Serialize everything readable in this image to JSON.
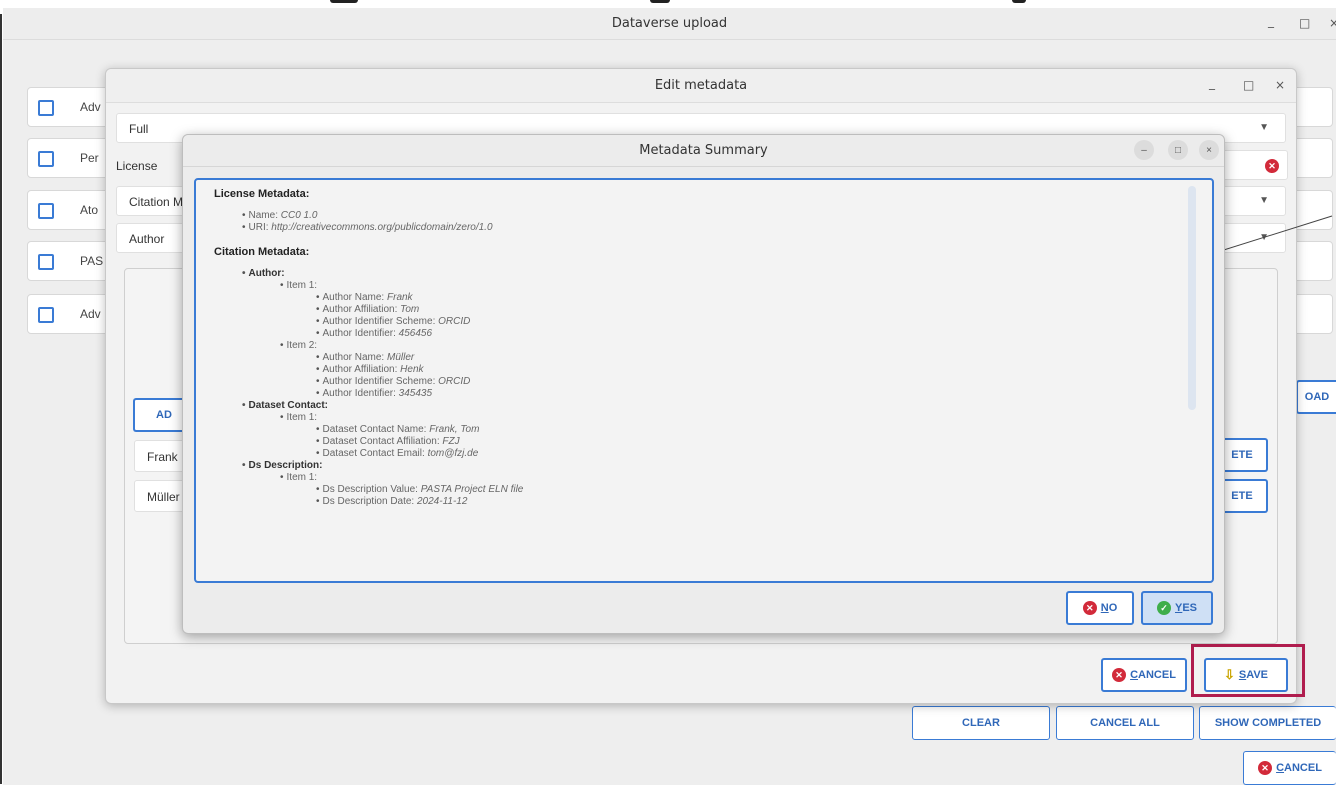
{
  "main_window": {
    "title": "Dataverse upload",
    "controls": [
      "_",
      "□",
      "×"
    ],
    "list_items": [
      "Adv",
      "Per",
      "Ato",
      "PAS",
      "Adv"
    ],
    "right_clip_upload": "OAD",
    "bottom_buttons": {
      "clear": "CLEAR",
      "cancel_all": "CANCEL ALL",
      "show_completed": "SHOW COMPLETED",
      "cancel_prefix": "C",
      "cancel_rest": "ANCEL"
    }
  },
  "edit_dialog": {
    "title": "Edit metadata",
    "controls": [
      "_",
      "□",
      "×"
    ],
    "type_select": "Full",
    "license_label": "License",
    "citation_label": "Citation M",
    "author_label": "Author",
    "add_clip": "AD",
    "author_rows": [
      "Frank",
      "Müller"
    ],
    "delete_clip": [
      "ETE",
      "ETE"
    ],
    "cancel_prefix": "C",
    "cancel_rest": "ANCEL",
    "save_prefix": "S",
    "save_rest": "AVE"
  },
  "summary_dialog": {
    "title": "Metadata Summary",
    "controls": [
      "–",
      "□",
      "×"
    ],
    "license_heading": "License Metadata:",
    "license_name_label": "Name: ",
    "license_name": "CC0 1.0",
    "license_uri_label": "URI: ",
    "license_uri": "http://creativecommons.org/publicdomain/zero/1.0",
    "citation_heading": "Citation Metadata:",
    "author_label": "Author:",
    "authors": [
      {
        "item": "Item 1:",
        "name": "Frank",
        "affiliation": "Tom",
        "scheme": "ORCID",
        "identifier": "456456"
      },
      {
        "item": "Item 2:",
        "name": "Müller",
        "affiliation": "Henk",
        "scheme": "ORCID",
        "identifier": "345435"
      }
    ],
    "f_author_name": "Author Name: ",
    "f_author_affiliation": "Author Affiliation: ",
    "f_author_scheme": "Author Identifier Scheme: ",
    "f_author_identifier": "Author Identifier: ",
    "contact_label": "Dataset Contact:",
    "contact_item": "Item 1:",
    "f_contact_name": "Dataset Contact Name: ",
    "contact_name": "Frank, Tom",
    "f_contact_affiliation": "Dataset Contact Affiliation: ",
    "contact_affiliation": "FZJ",
    "f_contact_email": "Dataset Contact Email: ",
    "contact_email": "tom@fzj.de",
    "desc_label": "Ds Description:",
    "desc_item": "Item 1:",
    "f_desc_value": "Ds Description Value: ",
    "desc_value": "PASTA Project ELN file",
    "f_desc_date": "Ds Description Date: ",
    "desc_date": "2024-11-12",
    "no_prefix": "N",
    "no_rest": "O",
    "yes_prefix": "Y",
    "yes_rest": "ES"
  },
  "colors": {
    "accent": "#3a7bd5",
    "danger": "#d22a3a",
    "success": "#3fae4a",
    "highlight": "#b01d4e"
  }
}
